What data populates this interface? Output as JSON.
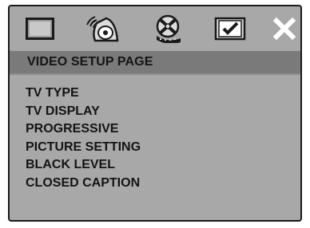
{
  "toolbar": {
    "icons": [
      {
        "name": "general-setup-icon"
      },
      {
        "name": "audio-setup-icon"
      },
      {
        "name": "video-setup-icon"
      },
      {
        "name": "preference-setup-icon"
      },
      {
        "name": "exit-icon"
      }
    ]
  },
  "page": {
    "title": "VIDEO SETUP PAGE"
  },
  "menu": {
    "items": [
      "TV TYPE",
      "TV DISPLAY",
      "PROGRESSIVE",
      "PICTURE SETTING",
      "BLACK LEVEL",
      "CLOSED CAPTION"
    ]
  },
  "colors": {
    "background": "#a8a8a8",
    "header": "#7a7a7a",
    "text": "#141414"
  }
}
